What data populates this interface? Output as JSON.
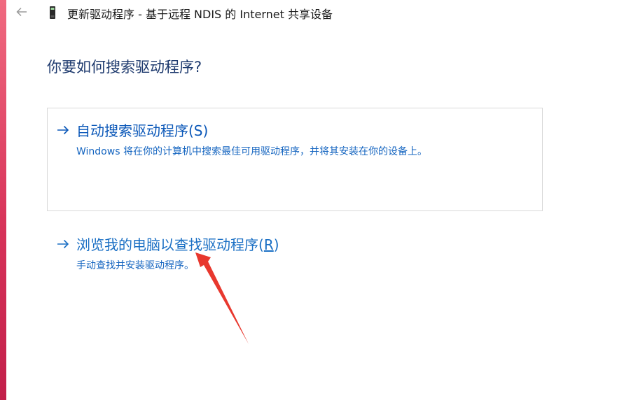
{
  "window": {
    "title": "更新驱动程序 - 基于远程 NDIS 的 Internet 共享设备",
    "back_icon": "back-arrow-icon",
    "device_icon": "network-device-icon"
  },
  "main": {
    "question": "你要如何搜索驱动程序?",
    "options": [
      {
        "title": "自动搜索驱动程序(S)",
        "description": "Windows 将在你的计算机中搜索最佳可用驱动程序，并将其安装在你的设备上。",
        "icon": "right-arrow-icon"
      },
      {
        "title_main": "浏览我的电脑以查找驱动程序(",
        "title_mnemonic": "R",
        "title_end": ")",
        "description": "手动查找并安装驱动程序。",
        "icon": "right-arrow-icon"
      }
    ]
  },
  "colors": {
    "accent": "#1a6fc4",
    "heading": "#1e3a6e",
    "annotation": "#e8382e"
  }
}
